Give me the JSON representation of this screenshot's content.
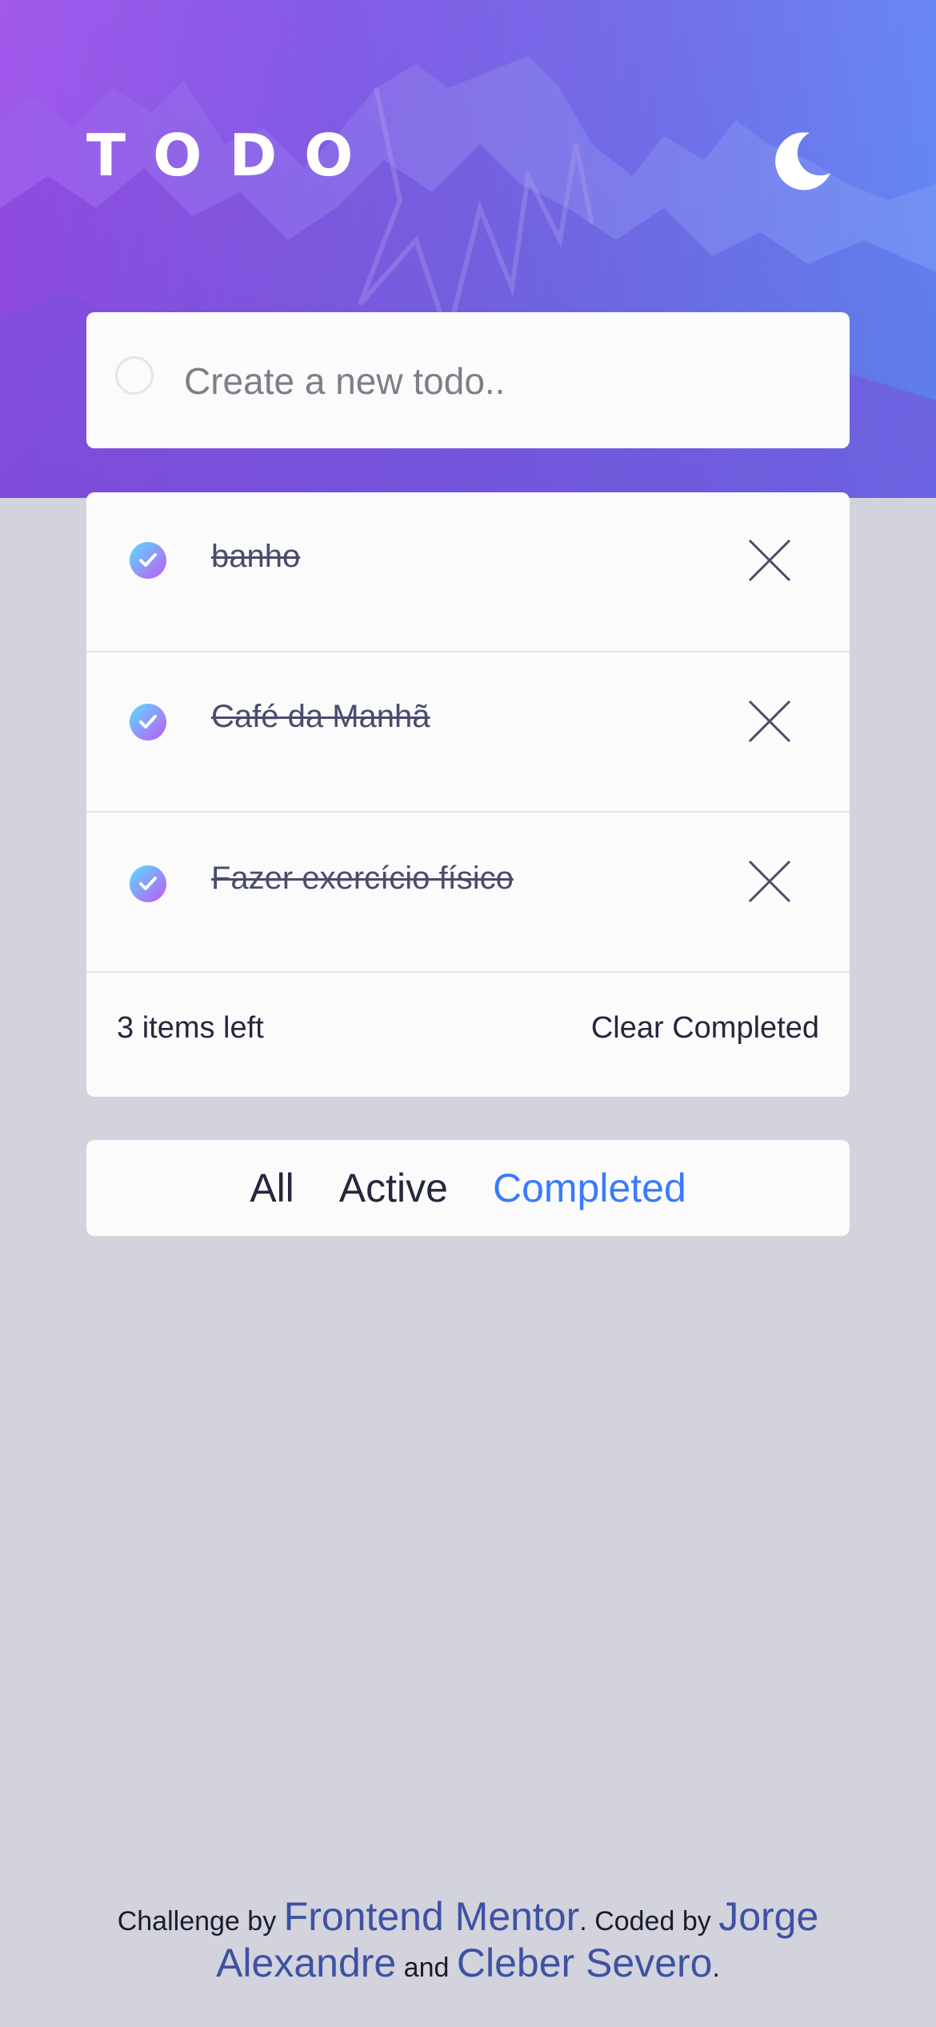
{
  "header": {
    "title": "TODO",
    "theme_toggle_icon": "moon-icon"
  },
  "new_todo": {
    "placeholder": "Create a new todo..",
    "value": ""
  },
  "todos": [
    {
      "text": "banho",
      "completed": true
    },
    {
      "text": "Café da Manhã",
      "completed": true
    },
    {
      "text": "Fazer exercício físico",
      "completed": true
    }
  ],
  "list_footer": {
    "items_left": "3 items left",
    "clear_completed": "Clear Completed"
  },
  "filters": [
    {
      "label": "All",
      "active": false
    },
    {
      "label": "Active",
      "active": false
    },
    {
      "label": "Completed",
      "active": true
    }
  ],
  "attribution": {
    "challenge_by": "Challenge by",
    "frontend_mentor": "Frontend Mentor",
    "coded_by": ". Coded by",
    "author1": "Jorge Alexandre",
    "and": "and",
    "author2": "Cleber Severo",
    "end": "."
  },
  "colors": {
    "accent_active": "#3a7bfd",
    "check_gradient_start": "#57ddff",
    "check_gradient_end": "#c058f3",
    "link": "#3e52a3",
    "page_bg": "#d2d3dc"
  }
}
